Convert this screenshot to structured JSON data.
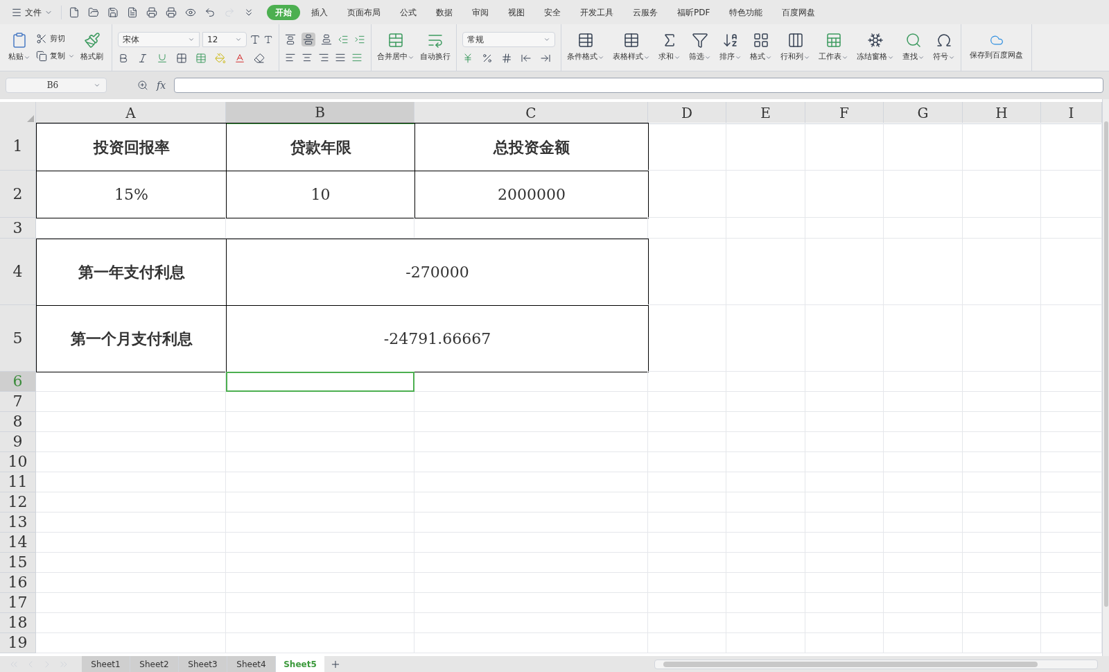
{
  "menu": {
    "file_label": "文件",
    "tabs": [
      {
        "label": "开始",
        "selected": true
      },
      {
        "label": "插入",
        "selected": false
      },
      {
        "label": "页面布局",
        "selected": false
      },
      {
        "label": "公式",
        "selected": false
      },
      {
        "label": "数据",
        "selected": false
      },
      {
        "label": "审阅",
        "selected": false
      },
      {
        "label": "视图",
        "selected": false
      },
      {
        "label": "安全",
        "selected": false
      },
      {
        "label": "开发工具",
        "selected": false
      },
      {
        "label": "云服务",
        "selected": false
      },
      {
        "label": "福昕PDF",
        "selected": false
      },
      {
        "label": "特色功能",
        "selected": false
      },
      {
        "label": "百度网盘",
        "selected": false
      }
    ]
  },
  "ribbon": {
    "paste": {
      "label": "粘贴",
      "has_menu": true
    },
    "clipboard": [
      {
        "label": "剪切",
        "has_menu": false
      },
      {
        "label": "复制",
        "has_menu": true
      }
    ],
    "format_painter": "格式刷",
    "font_name": "宋体",
    "font_size": "12",
    "number_format": "常规",
    "merge_buttons": [
      {
        "label": "合并居中",
        "has_menu": true
      },
      {
        "label": "自动换行",
        "has_menu": false
      }
    ],
    "tools": [
      {
        "label": "条件格式",
        "has_menu": true
      },
      {
        "label": "表格样式",
        "has_menu": true
      },
      {
        "label": "求和",
        "has_menu": true
      },
      {
        "label": "筛选",
        "has_menu": true
      },
      {
        "label": "排序",
        "has_menu": true
      },
      {
        "label": "格式",
        "has_menu": true
      },
      {
        "label": "行和列",
        "has_menu": true
      },
      {
        "label": "工作表",
        "has_menu": true
      },
      {
        "label": "冻结窗格",
        "has_menu": true
      },
      {
        "label": "查找",
        "has_menu": true
      },
      {
        "label": "符号",
        "has_menu": true
      }
    ],
    "save_cloud": "保存到百度网盘"
  },
  "formula_bar": {
    "name_box": "B6",
    "fx": "fx"
  },
  "sheet": {
    "columns": [
      {
        "label": "A",
        "selected": false
      },
      {
        "label": "B",
        "selected": true
      },
      {
        "label": "C",
        "selected": false
      },
      {
        "label": "D",
        "selected": false
      },
      {
        "label": "E",
        "selected": false
      },
      {
        "label": "F",
        "selected": false
      },
      {
        "label": "G",
        "selected": false
      },
      {
        "label": "H",
        "selected": false
      },
      {
        "label": "I",
        "selected": false
      }
    ],
    "rows": [
      {
        "header": "1",
        "selected": false,
        "cells": [
          {
            "kind": "heading",
            "text": "投资回报率"
          },
          {
            "kind": "heading",
            "text": "贷款年限"
          },
          {
            "kind": "heading",
            "text": "总投资金额"
          }
        ]
      },
      {
        "header": "2",
        "selected": false,
        "cells": [
          {
            "kind": "value",
            "text": "15%"
          },
          {
            "kind": "value",
            "text": "10"
          },
          {
            "kind": "value",
            "text": "2000000"
          }
        ]
      },
      {
        "header": "3",
        "selected": false,
        "cells": []
      },
      {
        "header": "4",
        "selected": false,
        "cells": [
          {
            "kind": "heading",
            "text": "第一年支付利息"
          },
          {
            "kind": "merged_value",
            "text": "-270000"
          }
        ]
      },
      {
        "header": "5",
        "selected": false,
        "cells": [
          {
            "kind": "heading",
            "text": "第一个月支付利息"
          },
          {
            "kind": "merged_value",
            "text": "-24791.66667"
          }
        ]
      },
      {
        "header": "6",
        "selected": true,
        "cells": []
      },
      {
        "header": "7",
        "selected": false,
        "cells": []
      },
      {
        "header": "8",
        "selected": false,
        "cells": []
      },
      {
        "header": "9",
        "selected": false,
        "cells": []
      },
      {
        "header": "10",
        "selected": false,
        "cells": []
      },
      {
        "header": "11",
        "selected": false,
        "cells": []
      },
      {
        "header": "12",
        "selected": false,
        "cells": []
      },
      {
        "header": "13",
        "selected": false,
        "cells": []
      },
      {
        "header": "14",
        "selected": false,
        "cells": []
      },
      {
        "header": "15",
        "selected": false,
        "cells": []
      },
      {
        "header": "16",
        "selected": false,
        "cells": []
      },
      {
        "header": "17",
        "selected": false,
        "cells": []
      },
      {
        "header": "18",
        "selected": false,
        "cells": []
      },
      {
        "header": "19",
        "selected": false,
        "cells": []
      }
    ]
  },
  "sheet_tabs": [
    {
      "label": "Sheet1",
      "selected": false
    },
    {
      "label": "Sheet2",
      "selected": false
    },
    {
      "label": "Sheet3",
      "selected": false
    },
    {
      "label": "Sheet4",
      "selected": false
    },
    {
      "label": "Sheet5",
      "selected": true
    }
  ]
}
